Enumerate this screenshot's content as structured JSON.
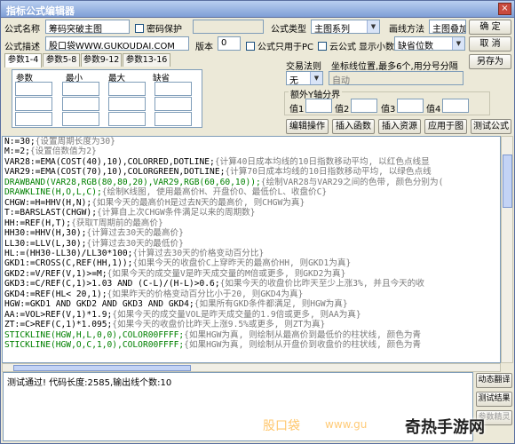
{
  "window": {
    "title": "指标公式编辑器",
    "close_glyph": "×"
  },
  "form": {
    "name_label": "公式名称",
    "name_value": "筹码突破主图",
    "password_label": "密码保护",
    "password_value": "",
    "desc_label": "公式描述",
    "desc_value": "股口袋WWW.GUKOUDAI.COM",
    "version_label": "版本",
    "version_value": "0",
    "main_only_label": "公式只用于PC",
    "cloud_label": "云公式",
    "formula_type_label": "公式类型",
    "formula_type_value": "主图系列",
    "draw_method_label": "画线方法",
    "draw_method_value": "主图叠加",
    "show_decimals_label": "显示小数",
    "show_decimals_value": "缺省位数"
  },
  "buttons": {
    "ok": "确 定",
    "cancel": "取 消",
    "save_as": "另存为",
    "edit_op": "编辑操作",
    "insert_func": "插入函数",
    "insert_resource": "插入资源",
    "apply_chart": "应用于图",
    "test_formula": "测试公式",
    "dynamic_translate": "动态翻译",
    "test_result": "测试结果",
    "param_wizard": "参数精灵"
  },
  "tabs": [
    "参数1-4",
    "参数5-8",
    "参数9-12",
    "参数13-16"
  ],
  "param_table": {
    "headers": [
      "参数",
      "最小",
      "最大",
      "缺省"
    ]
  },
  "trade_rule": {
    "label": "交易法则",
    "value": "无"
  },
  "coord": {
    "label": "坐标线位置,最多6个,用分号分隔",
    "value": "自动"
  },
  "extra_y": {
    "label": "额外Y轴分界",
    "labels": [
      "值1",
      "值2",
      "值3",
      "值4"
    ]
  },
  "code": {
    "colors": {
      "black": "#000000",
      "green": "#008000",
      "gray": "#7a7a7a",
      "purple": "#800080"
    },
    "lines": [
      [
        [
          "black",
          "N:=30;"
        ],
        [
          "gray",
          "{设置周期长度为30}"
        ]
      ],
      [
        [
          "black",
          "M:=2;"
        ],
        [
          "gray",
          "{设置倍数值为2}"
        ]
      ],
      [
        [
          "black",
          "VAR28:=EMA(COST(40),10),COLORRED,DOTLINE;"
        ],
        [
          "gray",
          "{计算40日成本均线的10日指数移动平均, 以红色点线显"
        ]
      ],
      [
        [
          "black",
          "VAR29:=EMA(COST(70),10),COLORGREEN,DOTLINE;"
        ],
        [
          "gray",
          "{计算70日成本均线的10日指数移动平均, 以绿色点线"
        ]
      ],
      [
        [
          "green",
          "DRAWBAND(VAR28,RGB(80,80,20),VAR29,RGB(60,60,10));"
        ],
        [
          "gray",
          "{绘制VAR28与VAR29之间的色带, 颜色分别为("
        ]
      ],
      [
        [
          "green",
          "DRAWKLINE(H,O,L,C);"
        ],
        [
          "gray",
          "{绘制K线图, 使用最高价H、开盘价O、最低价L、收盘价C}"
        ]
      ],
      [
        [
          "black",
          "CHGW:=H=HHV(H,N);"
        ],
        [
          "gray",
          "{如果今天的最高价H是过去N天的最高价, 则CHGW为真}"
        ]
      ],
      [
        [
          "black",
          "T:=BARSLAST(CHGW);"
        ],
        [
          "gray",
          "{计算自上次CHGW条件满足以来的周期数}"
        ]
      ],
      [
        [
          "black",
          "HH:=REF(H,T);"
        ],
        [
          "gray",
          "{获取T周期前的最高价}"
        ]
      ],
      [
        [
          "black",
          "HH30:=HHV(H,30);"
        ],
        [
          "gray",
          "{计算过去30天的最高价}"
        ]
      ],
      [
        [
          "black",
          "LL30:=LLV(L,30);"
        ],
        [
          "gray",
          "{计算过去30天的最低价}"
        ]
      ],
      [
        [
          "black",
          "HL:=(HH30-LL30)/LL30*100;"
        ],
        [
          "gray",
          "{计算过去30天的价格变动百分比}"
        ]
      ],
      [
        [
          "black",
          "GKD1:=CROSS(C,REF(HH,1));"
        ],
        [
          "gray",
          "{如果今天的收盘价C上穿昨天的最高价HH, 则GKD1为真}"
        ]
      ],
      [
        [
          "black",
          "GKD2:=V/REF(V,1)>=M;"
        ],
        [
          "gray",
          "{如果今天的成交量V是昨天成交量的M倍或更多, 则GKD2为真}"
        ]
      ],
      [
        [
          "black",
          "GKD3:=C/REF(C,1)>1.03 AND (C-L)/(H-L)>0.6;"
        ],
        [
          "gray",
          "{如果今天的收盘价比昨天至少上涨3%, 并且今天的收"
        ]
      ],
      [
        [
          "black",
          "GKD4:=REF(HL< 20,1);"
        ],
        [
          "gray",
          "{如果昨天的价格变动百分比小于20, 则GKD4为真}"
        ]
      ],
      [
        [
          "black",
          "HGW:=GKD1 AND GKD2 AND GKD3 AND GKD4;"
        ],
        [
          "gray",
          "{如果所有GKD条件都满足, 则HGW为真}"
        ]
      ],
      [
        [
          "black",
          "AA:=VOL>REF(V,1)*1.9;"
        ],
        [
          "gray",
          "{如果今天的成交量VOL是昨天成交量的1.9倍或更多, 则AA为真}"
        ]
      ],
      [
        [
          "black",
          "ZT:=C>REF(C,1)*1.095;"
        ],
        [
          "gray",
          "{如果今天的收盘价比昨天上涨9.5%或更多, 则ZT为真}"
        ]
      ],
      [
        [
          "green",
          "STICKLINE(HGW,H,L,0,0),COLOR00FFFF;"
        ],
        [
          "gray",
          "{如果HGW为真, 则绘制从最高价到最低价的柱状线, 颜色为青"
        ]
      ],
      [
        [
          "green",
          "STICKLINE(HGW,O,C,1,0),COLOR00FFFF;"
        ],
        [
          "gray",
          "{如果HGW为真, 则绘制从开盘价到收盘价的柱状线, 颜色为青"
        ]
      ]
    ]
  },
  "status": {
    "text": "测试通过! 代码长度:2585,输出线个数:10"
  },
  "watermarks": {
    "center": "股口袋",
    "center_url": "www.gu",
    "corner": "奇热手游网"
  }
}
